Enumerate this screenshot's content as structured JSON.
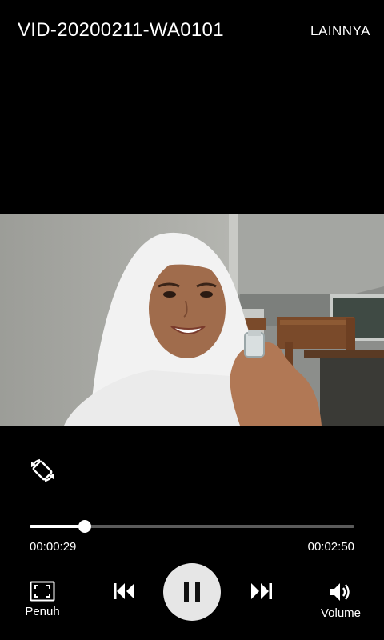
{
  "header": {
    "title": "VID-20200211-WA0101",
    "more_label": "LAINNYA"
  },
  "player": {
    "current_time": "00:00:29",
    "total_time": "00:02:50",
    "progress": 0.171
  },
  "controls": {
    "fullscreen_label": "Penuh",
    "volume_label": "Volume",
    "icons": [
      "rotate-icon",
      "fullscreen-icon",
      "previous-icon",
      "pause-icon",
      "next-icon",
      "volume-icon"
    ]
  },
  "colors": {
    "background": "#000000",
    "seek_fill": "#ffffff",
    "seek_track": "#5b5b5b",
    "play_button": "#e6e6e6"
  }
}
